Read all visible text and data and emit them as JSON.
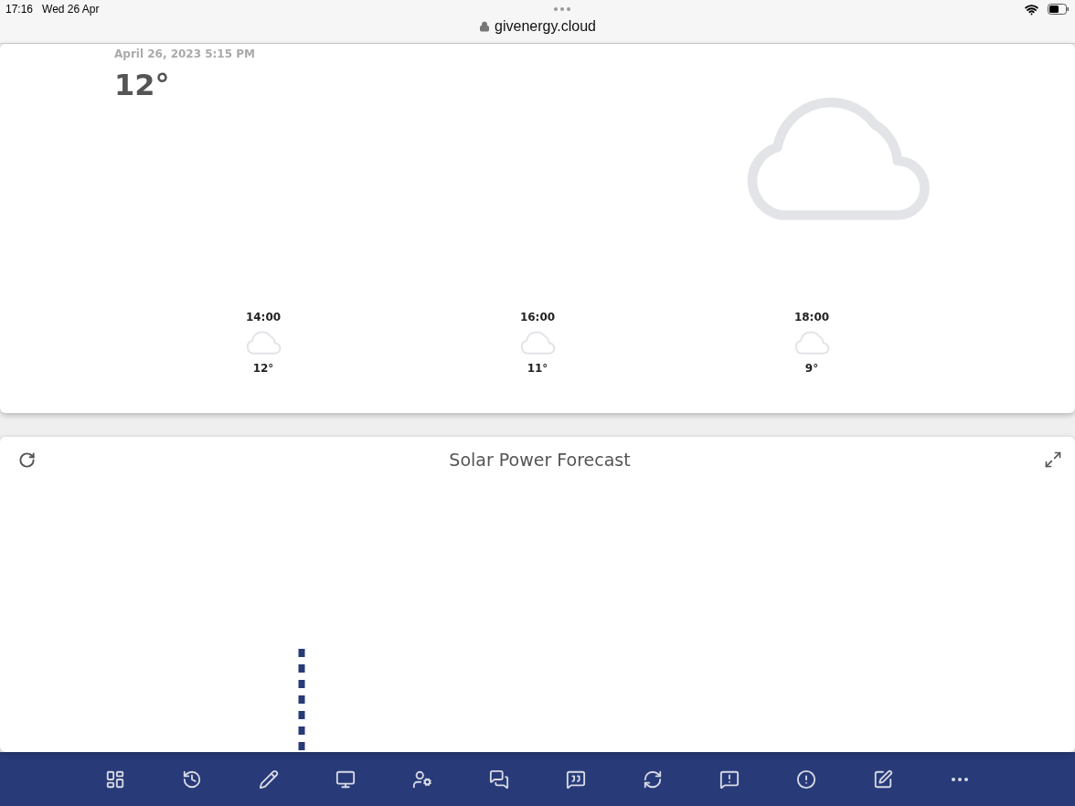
{
  "status_bar": {
    "time": "17:16",
    "date": "Wed 26 Apr"
  },
  "address_bar": {
    "url": "givenergy.cloud"
  },
  "weather": {
    "timestamp": "April 26, 2023 5:15 PM",
    "temperature": "12°",
    "forecast": [
      {
        "time": "14:00",
        "temperature": "12°"
      },
      {
        "time": "16:00",
        "temperature": "11°"
      },
      {
        "time": "18:00",
        "temperature": "9°"
      }
    ]
  },
  "solar_card": {
    "title": "Solar Power Forecast"
  }
}
